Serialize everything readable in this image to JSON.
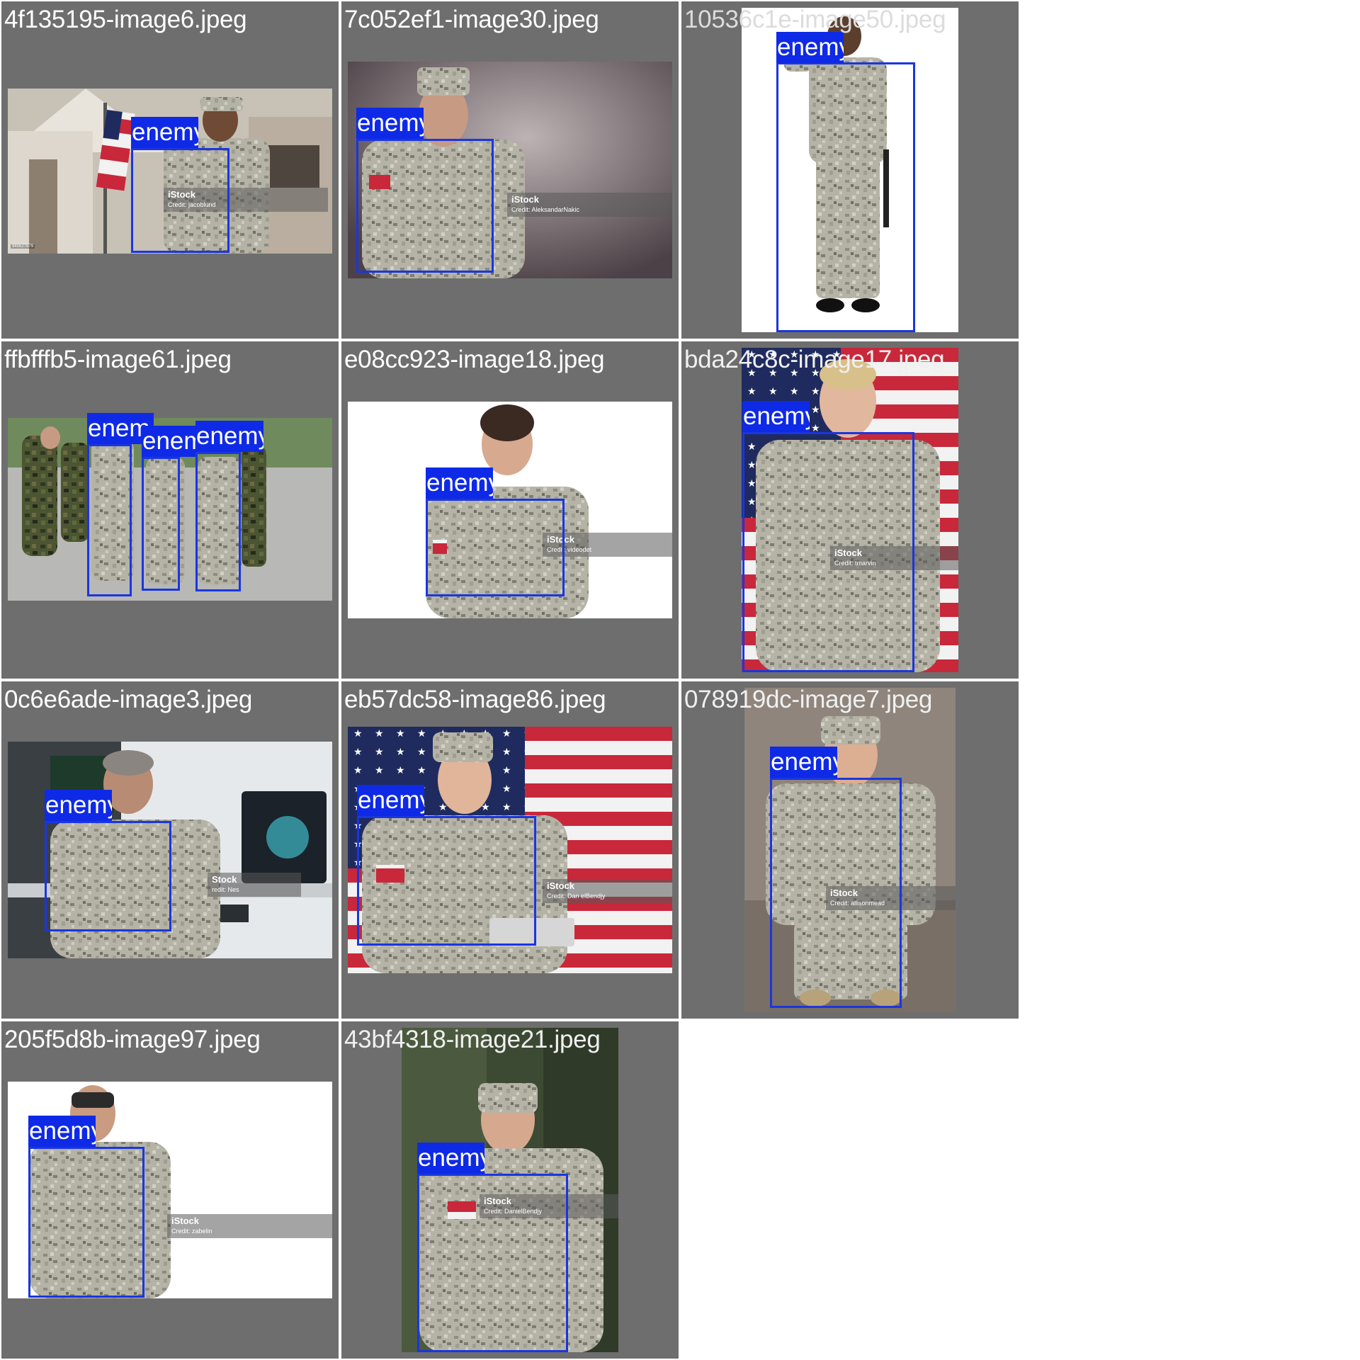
{
  "detection_label": "enemy",
  "colors": {
    "panel": "#6e6e6e",
    "box": "#1a36e0",
    "label_bg": "#0f2ae6",
    "title": "#ffffff"
  },
  "cells": [
    {
      "title": "4f135195-image6.jpeg",
      "watermark": {
        "brand": "iStock",
        "credit": "Credit: jacoblund"
      },
      "stock_id": "945627879",
      "labels": [
        "enemy"
      ]
    },
    {
      "title": "7c052ef1-image30.jpeg",
      "watermark": {
        "brand": "iStock",
        "credit": "Credit: AleksandarNakic"
      },
      "stock_id": "",
      "labels": [
        "enemy"
      ]
    },
    {
      "title": "10536c1e-image50.jpeg",
      "watermark": {
        "brand": "",
        "credit": ""
      },
      "stock_id": "",
      "labels": [
        "enemy"
      ]
    },
    {
      "title": "ffbfffb5-image61.jpeg",
      "watermark": {
        "brand": "",
        "credit": ""
      },
      "stock_id": "",
      "labels": [
        "enem",
        "enem",
        "enemy"
      ]
    },
    {
      "title": "e08cc923-image18.jpeg",
      "watermark": {
        "brand": "iStock",
        "credit": "Credit: videodet"
      },
      "stock_id": "",
      "labels": [
        "enemy"
      ]
    },
    {
      "title": "bda24c8c-image17.jpeg",
      "watermark": {
        "brand": "iStock",
        "credit": "Credit: tmarvin"
      },
      "stock_id": "",
      "labels": [
        "enemy"
      ]
    },
    {
      "title": "0c6e6ade-image3.jpeg",
      "watermark": {
        "brand": "Stock",
        "credit": "redit: Nes"
      },
      "stock_id": "",
      "labels": [
        "enemy"
      ]
    },
    {
      "title": "eb57dc58-image86.jpeg",
      "watermark": {
        "brand": "iStock",
        "credit": "Credit: Dan  elBendjy"
      },
      "stock_id": "",
      "labels": [
        "enemy"
      ]
    },
    {
      "title": "078919dc-image7.jpeg",
      "watermark": {
        "brand": "iStock",
        "credit": "Credit: allisonmead"
      },
      "stock_id": "",
      "labels": [
        "enemy"
      ]
    },
    {
      "title": "205f5d8b-image97.jpeg",
      "watermark": {
        "brand": "iStock",
        "credit": "Credit: zabelin"
      },
      "stock_id": "",
      "labels": [
        "enemy"
      ]
    },
    {
      "title": "43bf4318-image21.jpeg",
      "watermark": {
        "brand": "iStock",
        "credit": "Credit: DanielBendjy"
      },
      "stock_id": "",
      "labels": [
        "enemy"
      ]
    }
  ]
}
